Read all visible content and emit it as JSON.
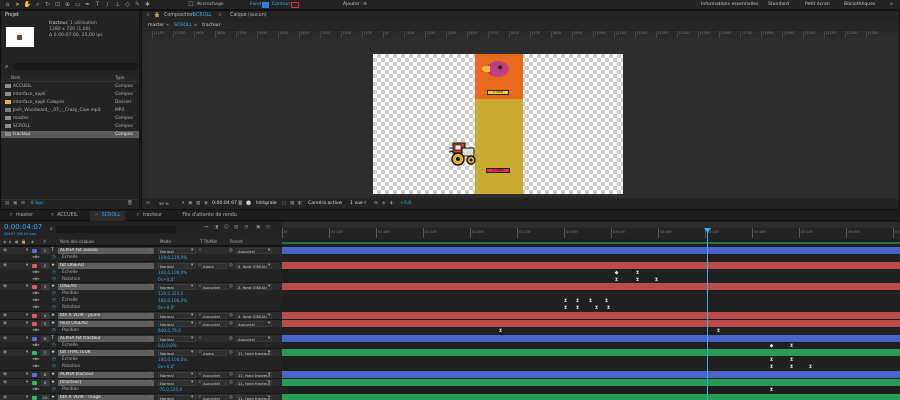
{
  "toolbar": {
    "snap_label": "Accrochage",
    "fill_label": "Fond",
    "stroke_label": "Contour",
    "add_label": "Ajouter :",
    "workspaces": [
      "Informations essentielles",
      "Standard",
      "Petit écran",
      "Bibliothèques"
    ]
  },
  "project": {
    "tab": "Projet",
    "item_name": "tracteur",
    "item_usage": ", 1 utilisation",
    "item_size": "1280 x 720 (1,00)",
    "item_duration": "Δ 0:00:07:00, 25,00 ips",
    "search_icon": "search-icon",
    "col_name": "Nom",
    "col_type": "Type",
    "items": [
      {
        "name": "ACCUEIL",
        "type": "Compos",
        "icon": "composition-icon",
        "color": "#8f8f8f"
      },
      {
        "name": "interface_appli",
        "type": "Compos",
        "icon": "composition-icon",
        "color": "#8f8f8f"
      },
      {
        "name": "interface_appli Calques",
        "type": "Dossier",
        "icon": "folder-icon",
        "color": "#d7b34a"
      },
      {
        "name": "Josh_Woodward_-_07_-_Crazy_Clue.mp3",
        "type": "MP3",
        "icon": "audio-icon",
        "color": "#7d7d7d"
      },
      {
        "name": "master",
        "type": "Compos",
        "icon": "composition-icon",
        "color": "#8f8f8f"
      },
      {
        "name": "SCROLL",
        "type": "Compos",
        "icon": "composition-icon",
        "color": "#8f8f8f"
      },
      {
        "name": "tracteur",
        "type": "Compos",
        "icon": "composition-icon",
        "color": "#8f8f8f",
        "selected": true
      }
    ],
    "bpc": "8 bpc"
  },
  "viewer": {
    "tab_prefix": "Composition",
    "tab_name": "SCROLL",
    "layer_tab": "Calque (aucun)",
    "crumbs": [
      "master",
      "SCROLL",
      "tracteur"
    ],
    "phone_button_top": "À VOIR",
    "phone_button_bottom": "À VOIR",
    "ruler_labels": [
      "|1100",
      "|1000",
      "|900",
      "|800",
      "|700",
      "|600",
      "|500",
      "|400",
      "|300",
      "|200",
      "|100",
      "|0",
      "|100",
      "|200",
      "|300",
      "|400",
      "|500",
      "|600",
      "|700",
      "|800",
      "|900",
      "|1000",
      "|1100",
      "|1200",
      "|1300",
      "|1400",
      "|1500",
      "|1600",
      "|1700",
      "|1800",
      "|1900",
      "|2000",
      "|2100",
      "|2200",
      "|2300"
    ],
    "zoom": "50 %",
    "time": "0:00:04:07",
    "quality": "Intégrale",
    "camera": "Caméra active",
    "views": "1 vue",
    "exposure": "+0,0"
  },
  "timeline": {
    "tabs": [
      "master",
      "ACCUEIL",
      "SCROLL",
      "tracteur"
    ],
    "active_tab": "SCROLL",
    "render_queue": "File d'attente de rendu",
    "time": "0:00:04:07",
    "frame": "00107 (25.00 ips)",
    "col_headers": {
      "name": "Nom des calques",
      "mode": "Mode",
      "trkmat": "T TrkMat",
      "parent": "Parent"
    },
    "ruler": [
      "0f",
      "00:15f",
      "01:00f",
      "01:15f",
      "02:00f",
      "02:15f",
      "03:00f",
      "03:15f",
      "04:00f",
      "04:15f",
      "05:00f",
      "05:15f",
      "06:00f",
      "06:15f"
    ],
    "layers": [
      {
        "kind": "main",
        "num": "1",
        "name": "ALPHA txt oiseau",
        "mode": "Normal",
        "trk": "",
        "parent": "Aucun(e)",
        "color": "#5b6ee0",
        "bar": "#4b64c8",
        "label": "#8faaf0",
        "kf": [],
        "boxed": true,
        "tstar": true
      },
      {
        "kind": "sub",
        "name": "Échelle",
        "val": "119,0,119,0%",
        "bar": "#232323",
        "kf": []
      },
      {
        "kind": "main",
        "num": "2",
        "name": "txt OISEAU",
        "mode": "Normal",
        "trk": "Alpha",
        "parent": "5. fond OISEAU",
        "color": "#e05a5a",
        "bar": "#b84a4a",
        "label": "#e57373",
        "kf": [],
        "boxed": true
      },
      {
        "kind": "sub",
        "name": "Échelle",
        "val": "100,0,100,0%",
        "bar": "#232323",
        "kf": [
          [
            616,
            "◆"
          ],
          [
            637,
            "⧗"
          ]
        ]
      },
      {
        "kind": "sub",
        "name": "Rotation",
        "val": "0x+0,0°",
        "bar": "#232323",
        "kf": [
          [
            616,
            "⧗"
          ],
          [
            637,
            "⧗"
          ],
          [
            656,
            "⧗"
          ]
        ]
      },
      {
        "kind": "main",
        "num": "3",
        "name": "OISEAU",
        "mode": "Normal",
        "trk": "Aucun(e)",
        "parent": "5. fond OISEAU",
        "color": "#e05a5a",
        "bar": "#b84a4a",
        "label": "#e57373",
        "kf": [],
        "boxed": true
      },
      {
        "kind": "sub",
        "name": "Position",
        "val": "128,0,323,5",
        "bar": "#232323",
        "kf": []
      },
      {
        "kind": "sub",
        "name": "Échelle",
        "val": "100,0,100,0%",
        "bar": "#232323",
        "kf": [
          [
            565,
            "⧗"
          ],
          [
            577,
            "⧗"
          ],
          [
            590,
            "⧗"
          ],
          [
            606,
            "⧗"
          ]
        ]
      },
      {
        "kind": "sub",
        "name": "Rotation",
        "val": "0x+0,0°",
        "bar": "#232323",
        "kf": [
          [
            565,
            "⧗"
          ],
          [
            577,
            "⧗"
          ],
          [
            596,
            "⧗"
          ],
          [
            608,
            "⧗"
          ]
        ]
      },
      {
        "kind": "main",
        "num": "4",
        "name": "btn À VOIR - jaune",
        "mode": "Normal",
        "trk": "Aucun(e)",
        "parent": "5. fond OISEAU",
        "color": "#e05a5a",
        "bar": "#b84a4a",
        "label": "#e57373",
        "kf": [],
        "boxed": true
      },
      {
        "kind": "main",
        "num": "5",
        "name": "fond OISEAU",
        "mode": "Normal",
        "trk": "Aucun(e)",
        "parent": "Aucun(e)",
        "color": "#e05a5a",
        "bar": "#b84a4a",
        "label": "#e57373",
        "kf": [],
        "boxed": true
      },
      {
        "kind": "sub",
        "name": "Position",
        "val": "640,0,79,3",
        "bar": "#232323",
        "kf": [
          [
            500,
            "⧗"
          ],
          [
            718,
            "⧗"
          ]
        ]
      },
      {
        "kind": "main",
        "num": "6",
        "name": "ALPHA txt tracteur",
        "mode": "Normal",
        "trk": "",
        "parent": "Aucun(e)",
        "color": "#5b6ee0",
        "bar": "#4b64c8",
        "label": "#8faaf0",
        "kf": [],
        "boxed": true,
        "tstar": true
      },
      {
        "kind": "sub",
        "name": "Échelle",
        "val": "0,0,0,0%",
        "bar": "#232323",
        "kf": [
          [
            771,
            "◆"
          ],
          [
            791,
            "⧗"
          ]
        ]
      },
      {
        "kind": "main",
        "num": "7",
        "name": "txt TRACTEUR",
        "mode": "Normal",
        "trk": "Alpha",
        "parent": "11. fond tracteur",
        "color": "#2dbb64",
        "bar": "#279c55",
        "label": "#5ecf88",
        "kf": [],
        "boxed": true
      },
      {
        "kind": "sub",
        "name": "Échelle",
        "val": "100,0,100,0%",
        "bar": "#232323",
        "kf": [
          [
            771,
            "⧗"
          ],
          [
            791,
            "⧗"
          ]
        ]
      },
      {
        "kind": "sub",
        "name": "Rotation",
        "val": "0x+0,0°",
        "bar": "#232323",
        "kf": [
          [
            771,
            "⧗"
          ],
          [
            791,
            "⧗"
          ],
          [
            810,
            "⧗"
          ]
        ]
      },
      {
        "kind": "main",
        "num": "8",
        "name": "ALPHA tracteur",
        "mode": "Normal",
        "trk": "Aucun(e)",
        "parent": "11. fond tracteur",
        "color": "#5b6ee0",
        "bar": "#4b64c8",
        "label": "#8faaf0",
        "kf": [],
        "boxed": true
      },
      {
        "kind": "main",
        "num": "9",
        "name": "[tracteur]",
        "mode": "Normal",
        "trk": "Aucun(e)",
        "parent": "11. fond tracteur",
        "color": "#2dbb64",
        "bar": "#279c55",
        "label": "#5ecf88",
        "kf": [],
        "boxed": true
      },
      {
        "kind": "sub",
        "name": "Position",
        "val": "-70,0,205,0",
        "bar": "#232323",
        "kf": [
          [
            771,
            "⧗"
          ]
        ]
      },
      {
        "kind": "main",
        "num": "10",
        "name": "btn À VOIR - rouge",
        "mode": "Normal",
        "trk": "Aucun(e)",
        "parent": "11. fond tracteur",
        "color": "#2dbb64",
        "bar": "#279c55",
        "label": "#5ecf88",
        "kf": [],
        "boxed": true
      },
      {
        "kind": "main",
        "num": "11",
        "name": "fond tracteur",
        "mode": "Normal",
        "trk": "Aucun(e)",
        "parent": "Aucun(e)",
        "color": "#2dbb64",
        "bar": "#279c55",
        "label": "#5ecf88",
        "kf": [],
        "boxed": true
      },
      {
        "kind": "sub",
        "name": "Position",
        "val": "640,0,489,5",
        "bar": "#232323",
        "kf": [
          [
            500,
            "⧗"
          ],
          [
            690,
            "⧗"
          ]
        ]
      }
    ]
  }
}
